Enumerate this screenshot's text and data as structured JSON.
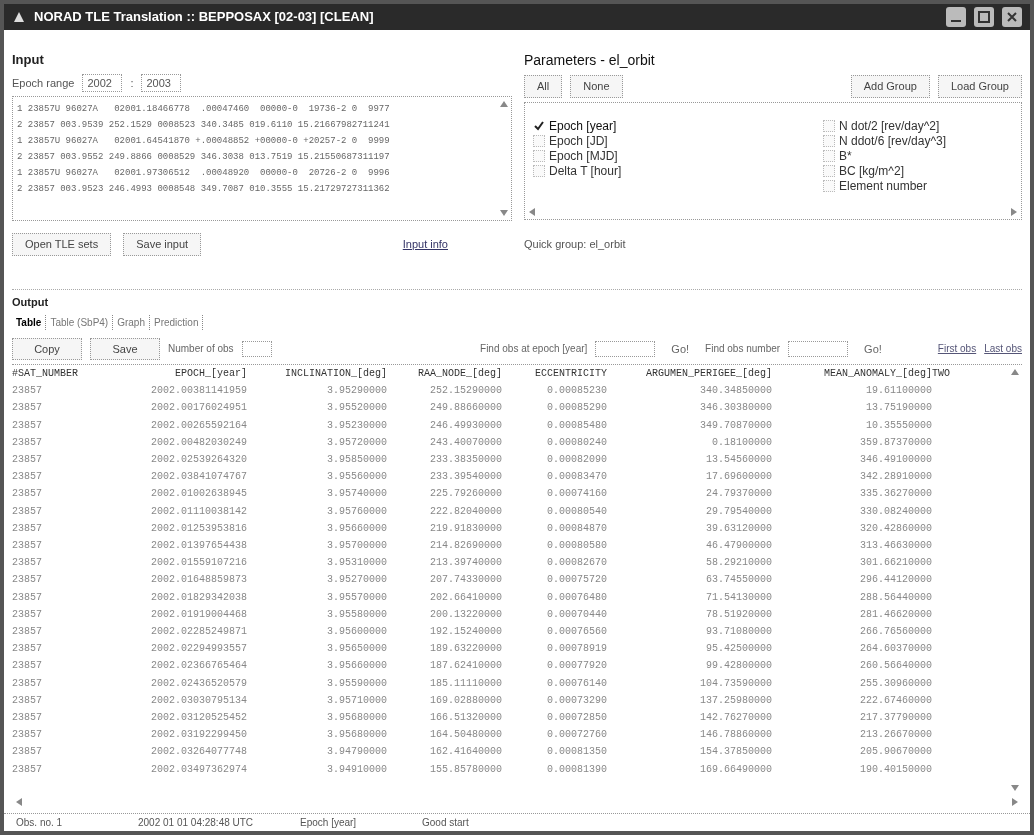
{
  "window": {
    "title": "NORAD TLE Translation :: BEPPOSAX [02-03] [CLEAN]"
  },
  "input": {
    "title": "Input",
    "epoch_range_label": "Epoch range",
    "epoch_from": "2002",
    "epoch_range_separator": ":",
    "epoch_to": "2003",
    "tle_lines": [
      "1 23857U 96027A   02001.18466778  .00047460  00000-0  19736-2 0  9977",
      "2 23857 003.9539 252.1529 0008523 340.3485 019.6110 15.21667982711241",
      "1 23857U 96027A   02001.64541870 +.00048852 +00000-0 +20257-2 0  9999",
      "2 23857 003.9552 249.8866 0008529 346.3038 013.7519 15.21550687311197",
      "1 23857U 96027A   02001.97306512  .00048920  00000-0  20726-2 0  9996",
      "2 23857 003.9523 246.4993 0008548 349.7087 010.3555 15.21729727311362"
    ],
    "buttons": [
      "Open TLE sets",
      "Save input"
    ],
    "info_link": "Input info"
  },
  "parameters": {
    "title": "Parameters - el_orbit",
    "buttons": [
      "All",
      "None",
      "Add Group",
      "Load Group"
    ],
    "items_left": [
      {
        "label": "Epoch [year]",
        "checked": true
      },
      {
        "label": "Epoch [JD]",
        "checked": false
      },
      {
        "label": "Epoch [MJD]",
        "checked": false
      },
      {
        "label": "Delta T [hour]",
        "checked": false
      }
    ],
    "items_right": [
      {
        "label": "N dot/2 [rev/day^2]",
        "checked": false
      },
      {
        "label": "N ddot/6 [rev/day^3]",
        "checked": false
      },
      {
        "label": "B*",
        "checked": false
      },
      {
        "label": "BC [kg/m^2]",
        "checked": false
      },
      {
        "label": "Element number",
        "checked": false
      }
    ],
    "quick_group": "Quick group: el_orbit"
  },
  "output": {
    "title": "Output",
    "tabs": [
      {
        "label": "Table",
        "selected": true
      },
      {
        "label": "Table (SbP4)",
        "selected": false
      },
      {
        "label": "Graph",
        "selected": false
      },
      {
        "label": "Prediction",
        "selected": false
      }
    ],
    "toolbar": {
      "copy": "Copy",
      "save": "Save",
      "number_label": "Number of obs",
      "find_epoch_label": "Find obs at epoch [year]",
      "go": "Go!",
      "find_number_label": "Find obs number",
      "go_2": "Go!",
      "first": "First obs",
      "last": "Last obs"
    },
    "table": {
      "columns": [
        "#SAT_NUMBER",
        "EPOCH_[year]",
        "INCLINATION_[deg]",
        "RAA_NODE_[deg]",
        "ECCENTRICITY",
        "ARGUMEN_PERIGEE_[deg]",
        "MEAN_ANOMALY_[deg]",
        "TWO"
      ],
      "rows": [
        [
          "23857",
          "2002.00381141959",
          "3.95290000",
          "252.15290000",
          "0.00085230",
          "340.34850000",
          "19.61100000"
        ],
        [
          "23857",
          "2002.00176024951",
          "3.95520000",
          "249.88660000",
          "0.00085290",
          "346.30380000",
          "13.75190000"
        ],
        [
          "23857",
          "2002.00265592164",
          "3.95230000",
          "246.49930000",
          "0.00085480",
          "349.70870000",
          "10.35550000"
        ],
        [
          "23857",
          "2002.00482030249",
          "3.95720000",
          "243.40070000",
          "0.00080240",
          "0.18100000",
          "359.87370000"
        ],
        [
          "23857",
          "2002.02539264320",
          "3.95850000",
          "233.38350000",
          "0.00082090",
          "13.54560000",
          "346.49100000"
        ],
        [
          "23857",
          "2002.03841074767",
          "3.95560000",
          "233.39540000",
          "0.00083470",
          "17.69600000",
          "342.28910000"
        ],
        [
          "23857",
          "2002.01002638945",
          "3.95740000",
          "225.79260000",
          "0.00074160",
          "24.79370000",
          "335.36270000"
        ],
        [
          "23857",
          "2002.01110038142",
          "3.95760000",
          "222.82040000",
          "0.00080540",
          "29.79540000",
          "330.08240000"
        ],
        [
          "23857",
          "2002.01253953816",
          "3.95660000",
          "219.91830000",
          "0.00084870",
          "39.63120000",
          "320.42860000"
        ],
        [
          "23857",
          "2002.01397654438",
          "3.95700000",
          "214.82690000",
          "0.00080580",
          "46.47900000",
          "313.46630000"
        ],
        [
          "23857",
          "2002.01559107216",
          "3.95310000",
          "213.39740000",
          "0.00082670",
          "58.29210000",
          "301.66210000"
        ],
        [
          "23857",
          "2002.01648859873",
          "3.95270000",
          "207.74330000",
          "0.00075720",
          "63.74550000",
          "296.44120000"
        ],
        [
          "23857",
          "2002.01829342038",
          "3.95570000",
          "202.66410000",
          "0.00076480",
          "71.54130000",
          "288.56440000"
        ],
        [
          "23857",
          "2002.01919004468",
          "3.95580000",
          "200.13220000",
          "0.00070440",
          "78.51920000",
          "281.46620000"
        ],
        [
          "23857",
          "2002.02285249871",
          "3.95600000",
          "192.15240000",
          "0.00076560",
          "93.71080000",
          "266.76560000"
        ],
        [
          "23857",
          "2002.02294993557",
          "3.95650000",
          "189.63220000",
          "0.00078919",
          "95.42500000",
          "264.60370000"
        ],
        [
          "23857",
          "2002.02366765464",
          "3.95660000",
          "187.62410000",
          "0.00077920",
          "99.42800000",
          "260.56640000"
        ],
        [
          "23857",
          "2002.02436520579",
          "3.95590000",
          "185.11110000",
          "0.00076140",
          "104.73590000",
          "255.30960000"
        ],
        [
          "23857",
          "2002.03030795134",
          "3.95710000",
          "169.02880000",
          "0.00073290",
          "137.25980000",
          "222.67460000"
        ],
        [
          "23857",
          "2002.03120525452",
          "3.95680000",
          "166.51320000",
          "0.00072850",
          "142.76270000",
          "217.37790000"
        ],
        [
          "23857",
          "2002.03192299450",
          "3.95680000",
          "164.50480000",
          "0.00072760",
          "146.78860000",
          "213.26670000"
        ],
        [
          "23857",
          "2002.03264077748",
          "3.94790000",
          "162.41640000",
          "0.00081350",
          "154.37850000",
          "205.90670000"
        ],
        [
          "23857",
          "2002.03497362974",
          "3.94910000",
          "155.85780000",
          "0.00081390",
          "169.66490000",
          "190.40150000"
        ]
      ]
    }
  },
  "status_bar": [
    "Obs. no. 1",
    "2002 01 01 04:28:48 UTC",
    "Epoch [year]",
    "Good start"
  ]
}
